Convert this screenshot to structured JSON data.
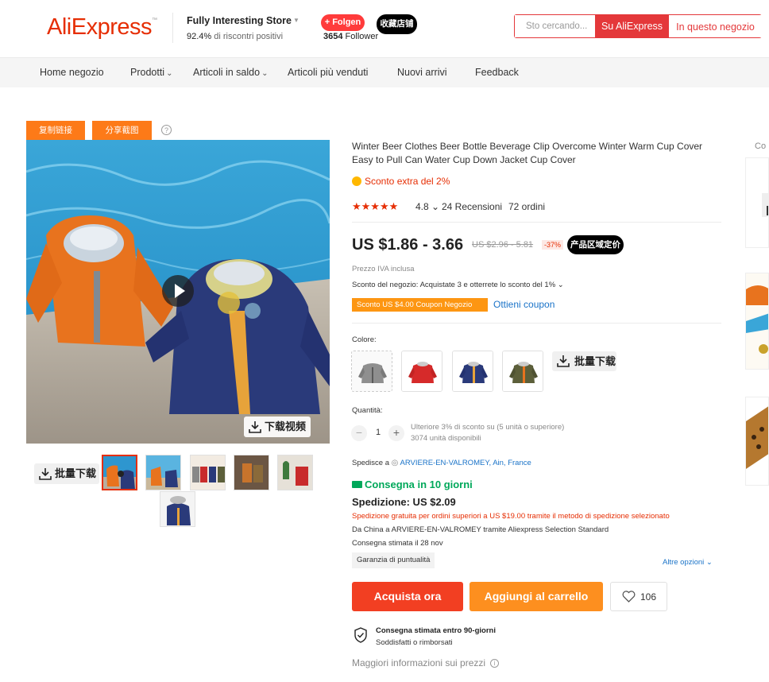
{
  "header": {
    "logo": "AliExpress",
    "store_name": "Fully Interesting Store",
    "rating_value": "92.4%",
    "rating_text": "di riscontri positivi",
    "follow_label": "+ Folgen",
    "follower_count": "3654",
    "follower_label": "Follower",
    "favorite_store_label": "收藏店铺",
    "search": {
      "placeholder": "Sto cercando...",
      "btn_aliexpress": "Su AliExpress",
      "btn_store": "In questo negozio"
    }
  },
  "nav": {
    "items": [
      {
        "label": "Home negozio",
        "has_caret": false
      },
      {
        "label": "Prodotti",
        "has_caret": true
      },
      {
        "label": "Articoli in saldo",
        "has_caret": true
      },
      {
        "label": "Articoli più venduti",
        "has_caret": false
      },
      {
        "label": "Nuovi arrivi",
        "has_caret": false
      },
      {
        "label": "Feedback",
        "has_caret": false
      }
    ],
    "caret_glyph": "⌄"
  },
  "gallery": {
    "copy_link_label": "复制链接",
    "share_image_label": "分享截图",
    "help_glyph": "?",
    "download_video_label": "下载视频",
    "batch_download_label": "批量下载",
    "thumbnail_count": 6
  },
  "product": {
    "title": "Winter Beer Clothes Beer Bottle Beverage Clip Overcome Winter Warm Cup Cover Easy to Pull Can Water Cup Down Jacket Cup Cover",
    "extra_discount": "Sconto extra del 2%",
    "stars": "★★★★★",
    "rating": "4.8",
    "rating_caret": "⌄",
    "reviews": "24 Recensioni",
    "orders": "72 ordini",
    "price": "US $1.86 - 3.66",
    "original_price": "US $2.96 - 5.81",
    "discount_badge": "-37%",
    "region_price_label": "产品区域定价",
    "vat_note": "Prezzo IVA inclusa",
    "store_discount": "Sconto del negozio: Acquistate 3 e otterrete lo sconto del 1% ⌄",
    "coupon_tag": "Sconto US $4.00 Coupon Negozio",
    "get_coupon": "Ottieni coupon"
  },
  "colors": {
    "label": "Colore:",
    "options": [
      "grey",
      "red",
      "navy",
      "olive"
    ],
    "batch_download_label": "批量下载"
  },
  "quantity": {
    "label": "Quantità:",
    "minus": "−",
    "value": "1",
    "plus": "+",
    "bulk_note": "Ulteriore 3% di sconto su (5 unità o superiore)",
    "available": "3074 unità disponibili"
  },
  "shipping": {
    "ship_to_label": "Spedisce a",
    "location": "ARVIERE-EN-VALROMEY, Ain, France",
    "delivery": "Consegna in 10 giorni",
    "cost": "Spedizione: US $2.09",
    "free_shipping_note": "Spedizione gratuita per ordini superiori a US $19.00 tramite il metodo di spedizione selezionato",
    "route": "Da China a ARVIERE-EN-VALROMEY tramite Aliexpress Selection Standard",
    "estimated": "Consegna stimata il 28 nov",
    "punctuality": "Garanzia di puntualità",
    "more_options": "Altre opzioni"
  },
  "actions": {
    "buy_now": "Acquista ora",
    "add_to_cart": "Aggiungi al carrello",
    "wishlist_count": "106"
  },
  "guarantee": {
    "title": "Consegna stimata entro 90-giorni",
    "subtitle": "Soddisfatti o rimborsati"
  },
  "more_price_info": "Maggiori informazioni sui prezzi",
  "side": {
    "label": "Co"
  },
  "theme": {
    "brand_red": "#e62e04",
    "orange": "#fd8f1f",
    "green": "#00a85a",
    "link_blue": "#1a73c8"
  }
}
